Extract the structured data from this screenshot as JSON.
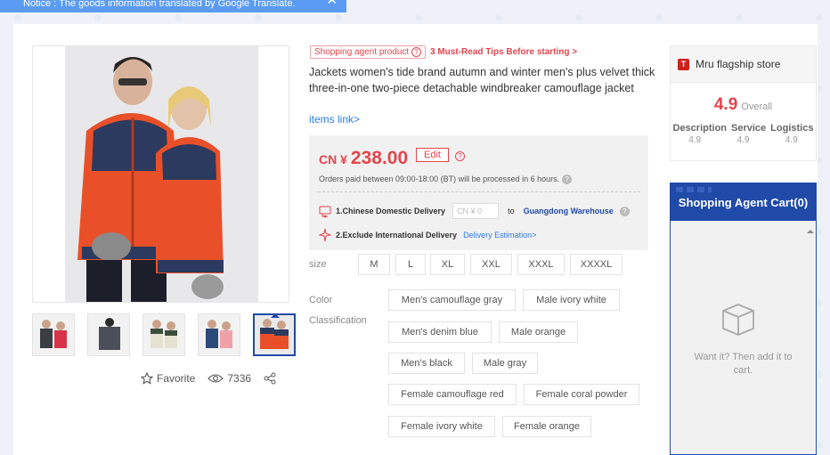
{
  "notice": {
    "text": "Notice : The goods information translated by Google Translate.",
    "close": "✕"
  },
  "product": {
    "badge": "Shopping agent product",
    "tips": "3 Must-Read Tips Before starting >",
    "title": "Jackets women's tide brand autumn and winter men's plus velvet thick three-in-one two-piece detachable windbreaker camouflage jacket",
    "items_link": "items link>",
    "price_currency": "CN ¥",
    "price_value": "238.00",
    "edit_label": "Edit",
    "orders_note": "Orders paid between 09:00-18:00 (BT) will be processed in 6 hours.",
    "domestic_label": "1.Chinese Domestic Delivery",
    "domestic_cn": "CN ¥",
    "domestic_value": "0",
    "to_label": "to",
    "warehouse": "Guangdong Warehouse",
    "intl_label": "2.Exclude International Delivery",
    "delivery_estimation": "Delivery Estimation>"
  },
  "options": {
    "size_label": "size",
    "sizes": [
      "M",
      "L",
      "XL",
      "XXL",
      "XXXL",
      "XXXXL"
    ],
    "color_label": "Color",
    "classification_label": "Classification",
    "colors": [
      "Men's camouflage gray",
      "Male ivory white",
      "Men's denim blue",
      "Male orange",
      "Men's black",
      "Male gray",
      "Female camouflage red",
      "Female coral powder",
      "Female ivory white",
      "Female orange"
    ]
  },
  "actions": {
    "favorite": "Favorite",
    "views": "7336"
  },
  "store": {
    "name": "Mru flagship store",
    "score": "4.9",
    "overall": "Overall",
    "rating_labels": [
      "Description",
      "Service",
      "Logistics"
    ],
    "rating_values": [
      "4.9",
      "4.9",
      "4.9"
    ]
  },
  "cart": {
    "title": "Shopping Agent Cart(0)",
    "empty_line1": "Want it? Then add it to",
    "empty_line2": "cart."
  },
  "colors": {
    "accent_red": "#e3454e",
    "brand_blue": "#1f4aa8",
    "link_blue": "#2e7be6",
    "jacket_orange": "#e9502a",
    "jacket_navy": "#2b3a5e"
  },
  "icons": [
    "close-icon",
    "help-icon",
    "truck-icon",
    "plane-icon",
    "star-icon",
    "eye-icon",
    "share-icon",
    "store-logo-icon",
    "box-icon"
  ]
}
